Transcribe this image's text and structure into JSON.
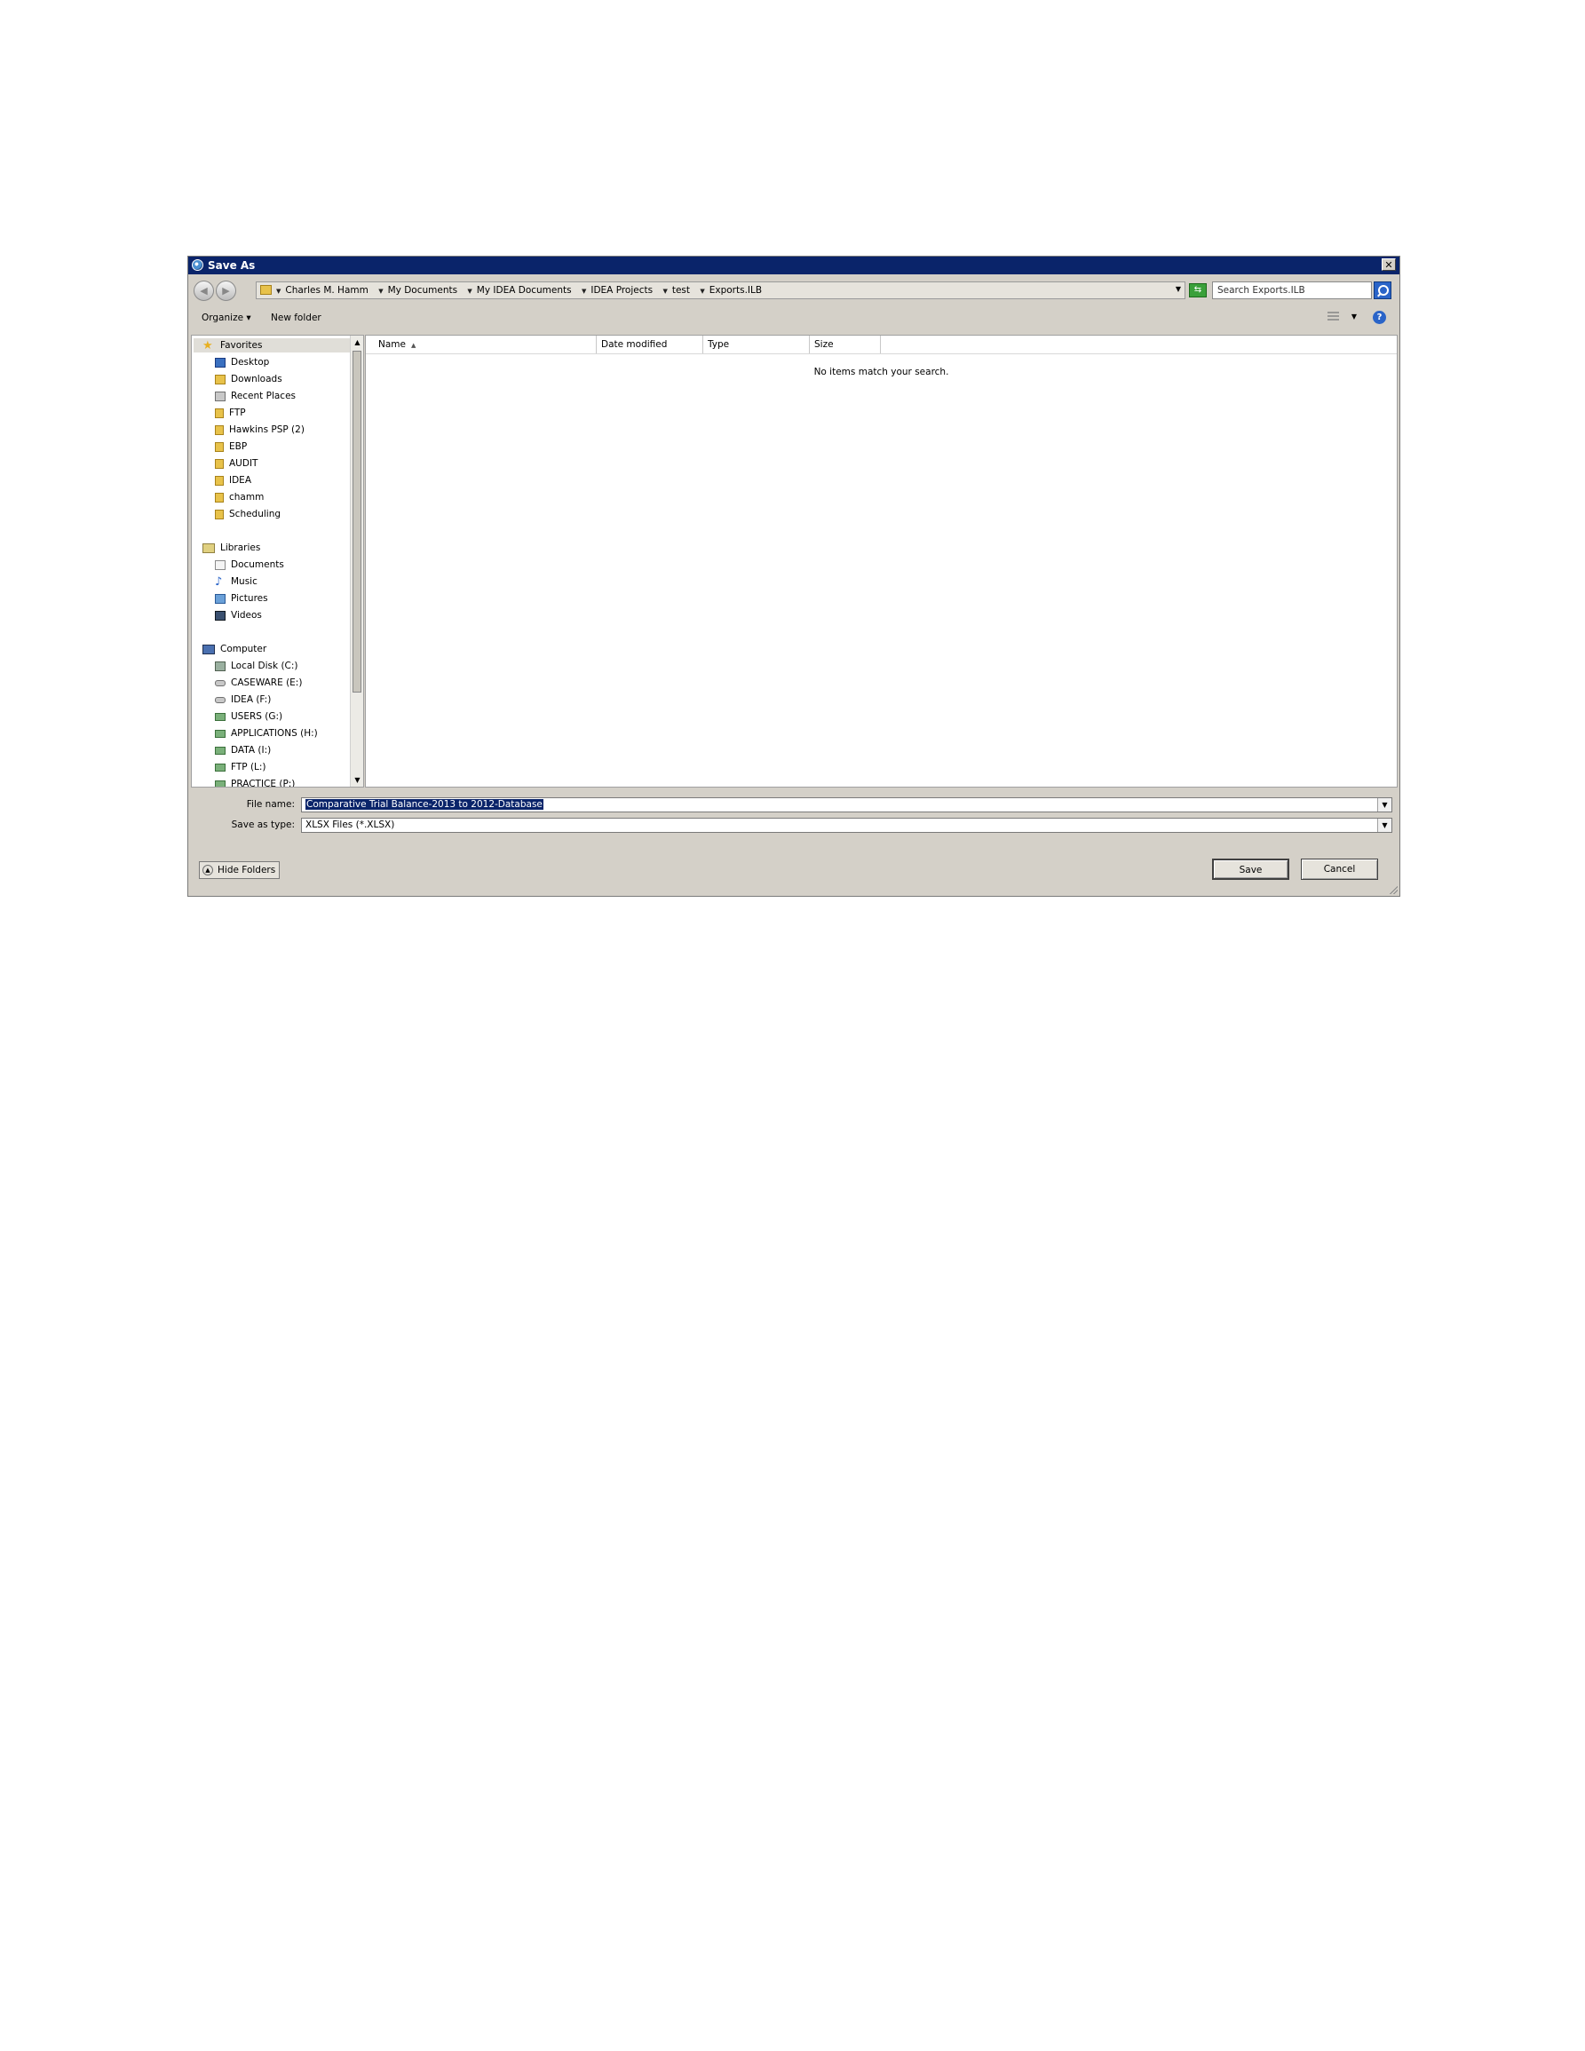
{
  "window": {
    "title": "Save As",
    "close_label": "✕"
  },
  "address": {
    "breadcrumbs": [
      "Charles M. Hamm",
      "My Documents",
      "My IDEA Documents",
      "IDEA Projects",
      "test",
      "Exports.ILB"
    ],
    "search_placeholder": "Search Exports.ILB"
  },
  "toolbar": {
    "organize_label": "Organize ▾",
    "new_folder_label": "New folder",
    "help_label": "?"
  },
  "nav": {
    "favorites_label": "Favorites",
    "favorites": [
      "Desktop",
      "Downloads",
      "Recent Places",
      "FTP",
      "Hawkins PSP (2)",
      "EBP",
      "AUDIT",
      "IDEA",
      "chamm",
      "Scheduling"
    ],
    "libraries_label": "Libraries",
    "libraries": [
      "Documents",
      "Music",
      "Pictures",
      "Videos"
    ],
    "computer_label": "Computer",
    "drives": [
      "Local Disk (C:)",
      "CASEWARE (E:)",
      "IDEA (F:)",
      "USERS (G:)",
      "APPLICATIONS (H:)",
      "DATA (I:)",
      "FTP (L:)",
      "PRACTICE (P:)"
    ]
  },
  "file_list": {
    "columns": [
      "Name",
      "Date modified",
      "Type",
      "Size"
    ],
    "empty_message": "No items match your search."
  },
  "fields": {
    "file_name_label": "File name:",
    "file_name_value": "Comparative Trial Balance-2013 to 2012-Database",
    "save_type_label": "Save as type:",
    "save_type_value": "XLSX Files (*.XLSX)"
  },
  "footer": {
    "hide_folders_label": "Hide Folders",
    "save_label": "Save",
    "cancel_label": "Cancel"
  }
}
